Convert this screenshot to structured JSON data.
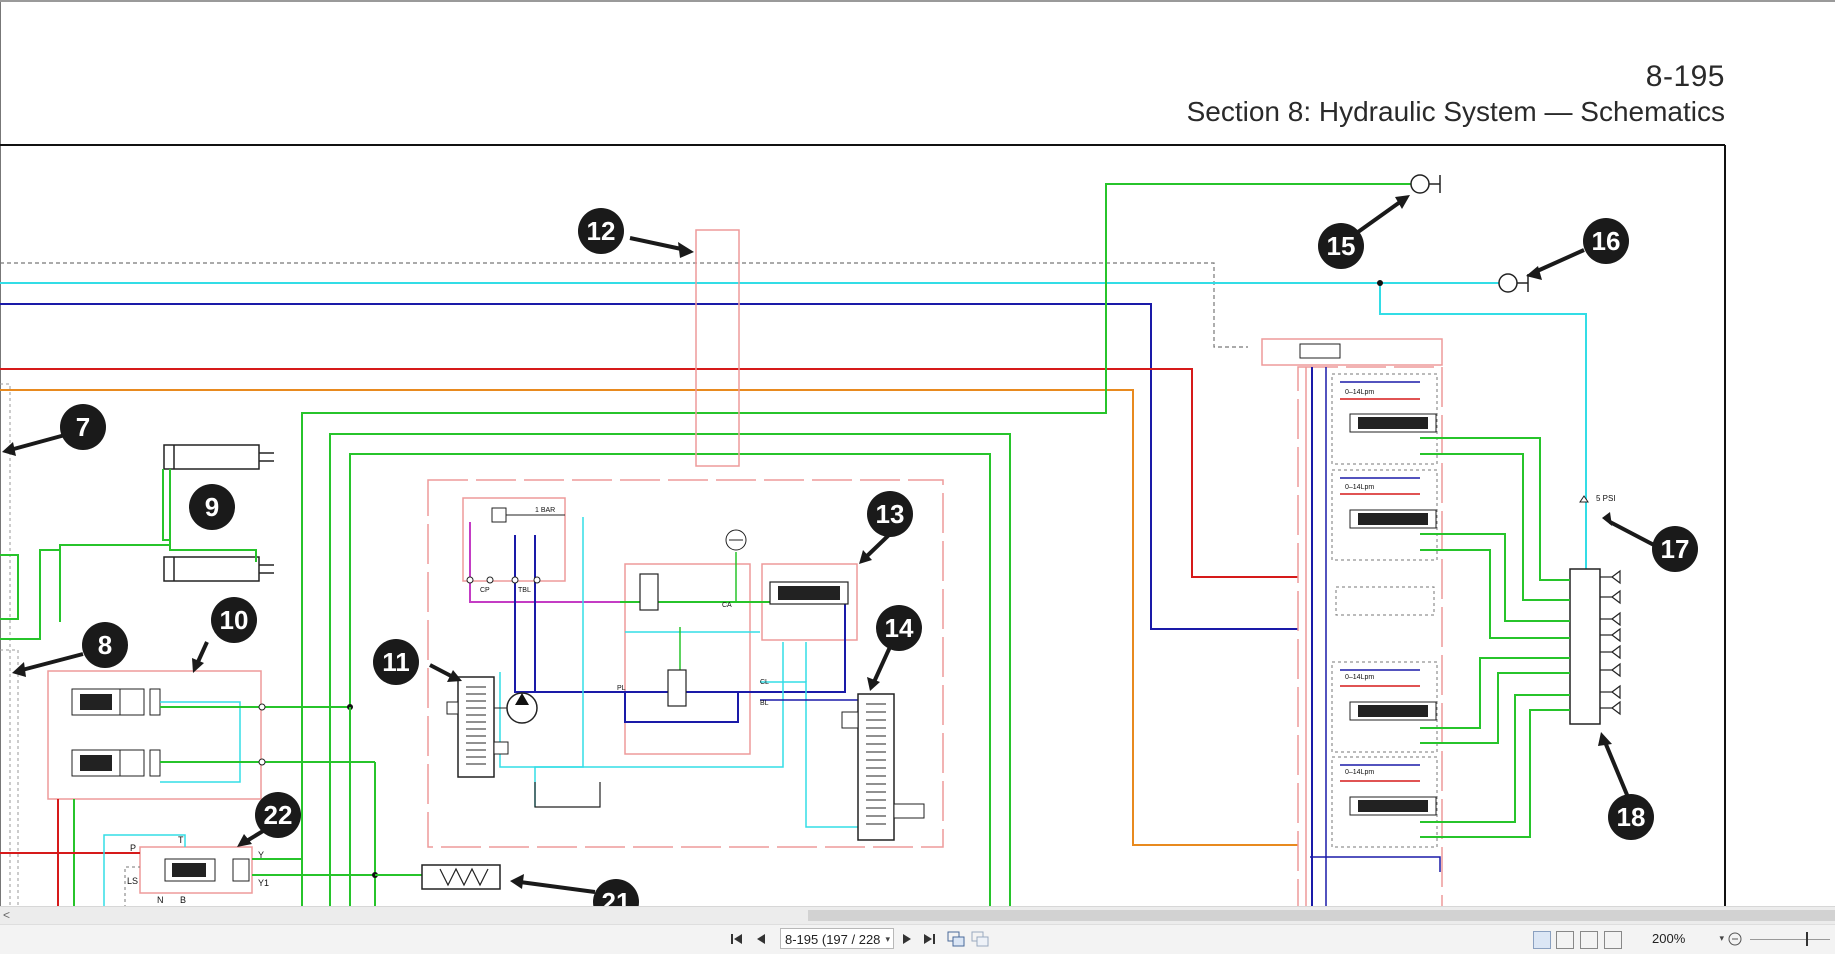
{
  "page": {
    "number": "8-195",
    "section_title": "Section 8: Hydraulic System — Schematics"
  },
  "callouts": [
    "7",
    "8",
    "9",
    "10",
    "11",
    "12",
    "13",
    "14",
    "15",
    "16",
    "17",
    "18",
    "21",
    "22"
  ],
  "schematic_labels": {
    "flow_a": "0–14Lpm",
    "flow_b": "0–14Lpm",
    "flow_c": "0–14Lpm",
    "flow_d": "0–14Lpm",
    "psi": "5 PSI",
    "bar": "1 BAR",
    "port_p": "P",
    "port_t": "T",
    "port_y": "Y",
    "port_y1": "Y1",
    "port_ls": "LS",
    "port_n": "N",
    "port_b": "B",
    "port_pl": "PL",
    "port_bl": "BL",
    "port_cl": "CL",
    "port_ca": "CA",
    "port_cp": "CP",
    "port_tbl": "TBL"
  },
  "toolbar": {
    "page_field": "8-195 (197 / 228",
    "zoom": "200%",
    "scroll_left": "<"
  },
  "icons": {
    "first_page": "first-page-icon",
    "prev_page": "prev-page-icon",
    "next_page": "next-page-icon",
    "last_page": "last-page-icon",
    "prev_view": "previous-view-icon",
    "next_view": "next-view-icon",
    "single_page": "single-page-view-icon",
    "continuous": "continuous-view-icon",
    "facing": "facing-view-icon",
    "scroll_mode": "scroll-mode-icon",
    "zoom_out": "zoom-out-icon"
  },
  "colors": {
    "cyan": "#33dde6",
    "blue": "#1a1aa8",
    "red": "#d61a1a",
    "orange": "#e88a1f",
    "green": "#27c42b",
    "pink": "#ee9a9a",
    "magenta": "#c43cc4",
    "callout": "#1a1a1a"
  }
}
